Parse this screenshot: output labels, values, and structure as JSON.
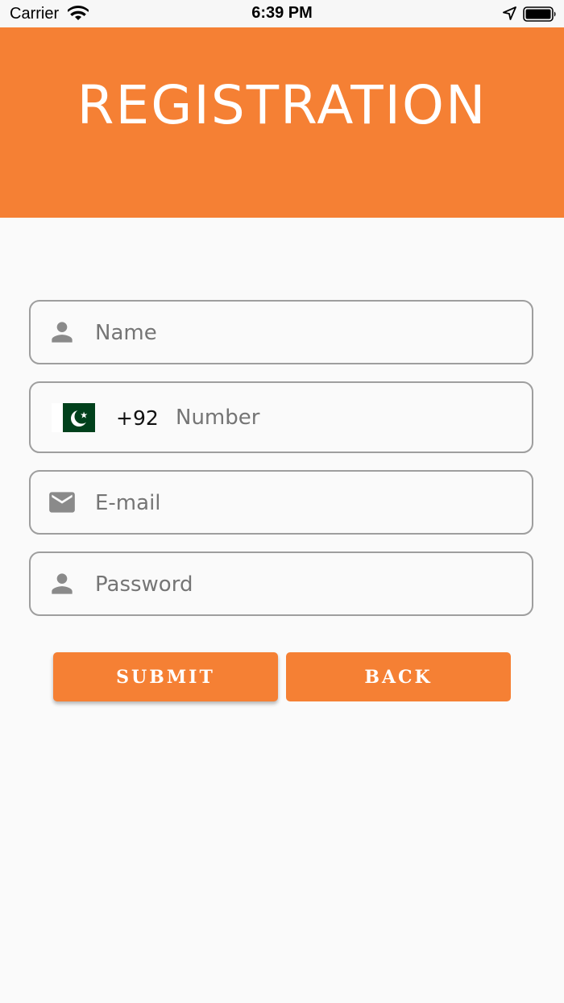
{
  "status_bar": {
    "carrier": "Carrier",
    "time": "6:39 PM"
  },
  "header": {
    "title": "REGISTRATION",
    "background_color": "#f58034"
  },
  "form": {
    "name": {
      "placeholder": "Name",
      "value": "",
      "icon": "person-icon"
    },
    "phone": {
      "flag": "pakistan-flag",
      "dial_code": "+92",
      "placeholder": "Number",
      "value": ""
    },
    "email": {
      "placeholder": "E-mail",
      "value": "",
      "icon": "mail-icon"
    },
    "password": {
      "placeholder": "Password",
      "value": "",
      "icon": "person-icon"
    }
  },
  "buttons": {
    "submit_label": "SUBMIT",
    "back_label": "BACK"
  }
}
